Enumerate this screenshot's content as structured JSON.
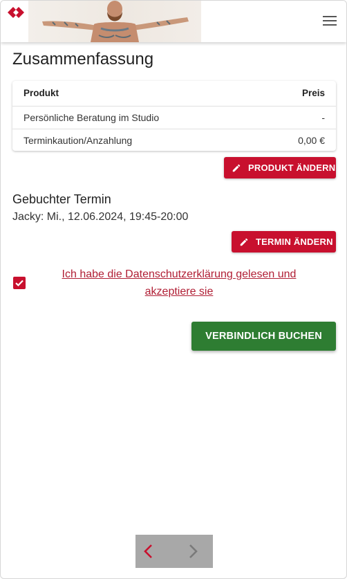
{
  "header": {
    "logo_icon": "diamond-logo-icon",
    "banner_image": "tattooed-man-banner",
    "menu_icon": "hamburger-menu-icon"
  },
  "page_title": "Zusammenfassung",
  "summary": {
    "headers": [
      "Produkt",
      "Preis"
    ],
    "rows": [
      {
        "produkt": "Persönliche Beratung im Studio",
        "preis": "-"
      },
      {
        "produkt": "Terminkaution/Anzahlung",
        "preis": "0,00 €"
      }
    ]
  },
  "buttons": {
    "produkt_aendern": "PRODUKT ÄNDERN",
    "termin_aendern": "TERMIN ÄNDERN",
    "verbindlich_buchen": "VERBINDLICH BUCHEN"
  },
  "termin": {
    "heading": "Gebuchter Termin",
    "detail": "Jacky: Mi., 12.06.2024, 19:45-20:00"
  },
  "consent": {
    "checked": true,
    "line1": "Ich habe die Datenschutzerklärung gelesen und",
    "line2": "akzeptiere sie"
  },
  "colors": {
    "accent_red": "#c8102e",
    "book_green": "#2e7d32",
    "pager_bg": "#a8a8a8"
  }
}
